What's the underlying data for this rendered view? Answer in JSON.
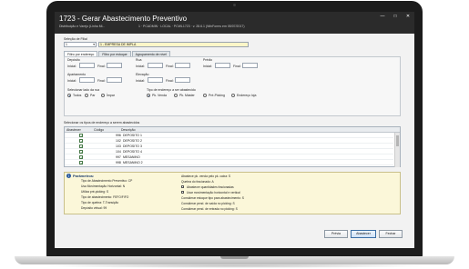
{
  "window": {
    "title": "1723 - Gerar Abastecimento Preventivo",
    "subtitle": "Distribuição e Varejo (Linha Mi...",
    "subtitle_status": "1 · PCADMIN · LOCAL · PCWL1723 · v. 28.6.1 (WinForms em 05/07/2017)",
    "minimize_glyph": "—",
    "maximize_glyph": "□",
    "close_glyph": "✕"
  },
  "filial": {
    "label": "Seleção de Filial",
    "code": "1",
    "dropdown_glyph": "▾",
    "name": "1 - EMPRESA DE IMPLA"
  },
  "tabs": [
    {
      "label": "Filtro por endereço"
    },
    {
      "label": "Filtro por estoque"
    },
    {
      "label": "Agrupamento de nível"
    }
  ],
  "filters": {
    "deposito": {
      "label": "Depósito",
      "inicial": "Inicial:",
      "final": "Final:"
    },
    "rua": {
      "label": "Rua",
      "inicial": "Inicial:",
      "final": "Final:"
    },
    "predio": {
      "label": "Prédio",
      "inicial": "Inicial:",
      "final": "Final:"
    },
    "apartamento": {
      "label": "Apartamento",
      "inicial": "Inicial:",
      "final": "Final:"
    },
    "elevacao": {
      "label": "Elevação",
      "inicial": "Inicial:",
      "final": "Final:"
    }
  },
  "lado_rua": {
    "label": "Selecionar lado da rua",
    "options": [
      "Todos",
      "Par",
      "Ímpar"
    ]
  },
  "tipo_endereco": {
    "label": "Tipo de endereço a ser abastecido",
    "options": [
      "Pk. Venda",
      "Pk. Máster",
      "Pré-Picking",
      "Endereço loja"
    ]
  },
  "grid": {
    "caption": "Selecionar os tipos de endereço a serem abastecidos",
    "columns": [
      "Abastecer",
      "Código",
      "Descrição"
    ],
    "rows": [
      {
        "codigo": "996",
        "descricao": "DEPOSITO 1"
      },
      {
        "codigo": "102",
        "descricao": "DEPOSITO 2"
      },
      {
        "codigo": "103",
        "descricao": "DEPOSITO 3"
      },
      {
        "codigo": "104",
        "descricao": "DEPOSITO 4"
      },
      {
        "codigo": "997",
        "descricao": "MESANINO"
      },
      {
        "codigo": "998",
        "descricao": "MESANINO 2"
      }
    ]
  },
  "parametros": {
    "info_glyph": "i",
    "title": "Parâmetros:",
    "left": [
      "Tipo de Abastecimento Preventivo: CP",
      "Usa Movimentação Horizontal: N",
      "Utiliza pré-picking: S",
      "Tipo de abastecimento: FEFO/FIFO",
      "Tipo de quebra: T-Transição",
      "Depósito virtual: 99"
    ],
    "right": [
      "Abastece pk. venda pelo pk. caixa: S",
      "Quebra do fracionado: A",
      "Abastecer quantidades fracionadas",
      "Usar movimentação horizontal e vertical",
      "Considerar estoque tipo para abastecimento: S",
      "Considerar pend. de saída no picking: S",
      "Considerar pend. de entrada no picking: S"
    ]
  },
  "buttons": {
    "previa": "Prévia",
    "abastecer": "Abastecer",
    "fechar": "Fechar"
  },
  "colors": {
    "titlebar": "#2b2b2b",
    "parameters_bg": "#fbf7d9",
    "filial_bg": "#fdf6c8"
  }
}
